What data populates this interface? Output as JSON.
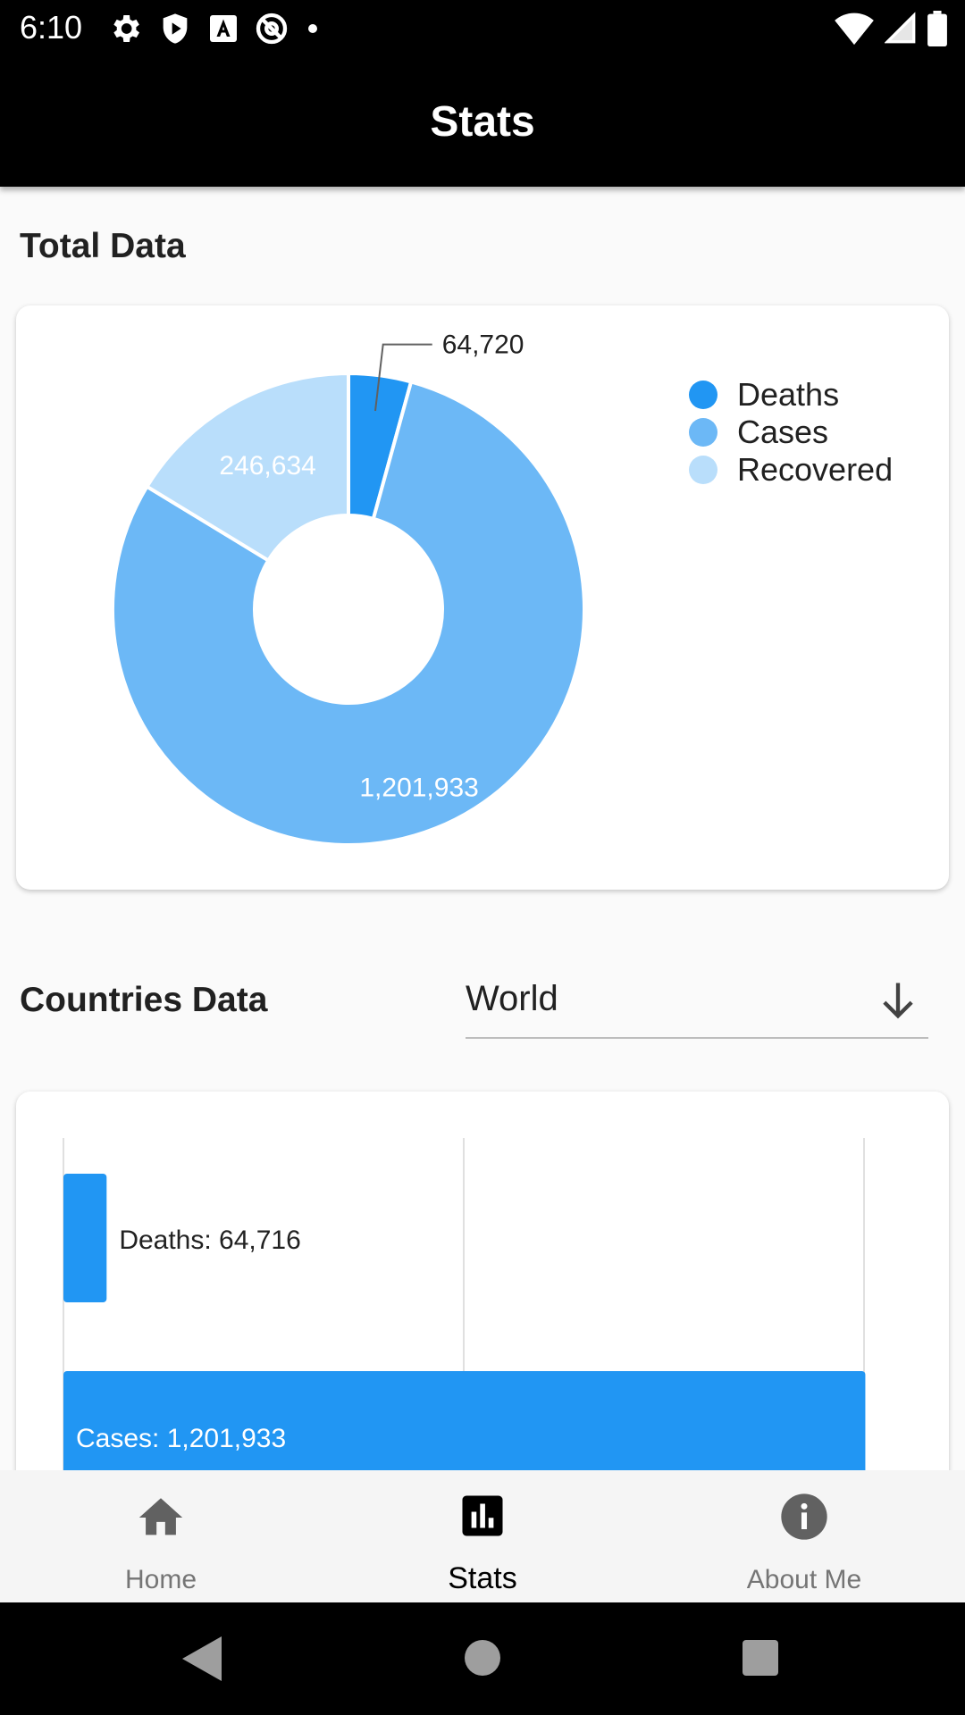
{
  "status_bar": {
    "time": "6:10",
    "left_icons": [
      "gear-icon",
      "shield-icon",
      "font-a-icon",
      "at-sign-icon",
      "dot-icon"
    ],
    "right_icons": [
      "wifi-icon",
      "signal-icon",
      "battery-icon"
    ]
  },
  "app_bar": {
    "title": "Stats"
  },
  "total_section": {
    "title": "Total Data"
  },
  "chart_donut": {
    "type": "pie",
    "categories": [
      "Deaths",
      "Cases",
      "Recovered"
    ],
    "values": [
      64720,
      1201933,
      246634
    ],
    "value_labels": [
      "64,720",
      "1,201,933",
      "246,634"
    ],
    "colors": [
      "#2196f3",
      "#6cb8f6",
      "#b9defb"
    ],
    "legend_position": "top-right"
  },
  "countries_section": {
    "title": "Countries Data",
    "dropdown_value": "World",
    "dropdown_icon": "arrow-down-icon"
  },
  "chart_bar": {
    "type": "bar",
    "orientation": "horizontal",
    "categories": [
      "Deaths",
      "Cases"
    ],
    "values": [
      64716,
      1201933
    ],
    "labels": [
      "Deaths: 64,716",
      "Cases: 1,201,933"
    ],
    "color": "#2196f3",
    "grid": true
  },
  "bottom_nav": {
    "items": [
      {
        "label": "Home",
        "icon": "home-icon"
      },
      {
        "label": "Stats",
        "icon": "bar-chart-icon"
      },
      {
        "label": "About Me",
        "icon": "info-icon"
      }
    ],
    "active": "Stats"
  },
  "system_nav": {
    "icons": [
      "back-icon",
      "home-circle-icon",
      "recents-icon"
    ]
  }
}
